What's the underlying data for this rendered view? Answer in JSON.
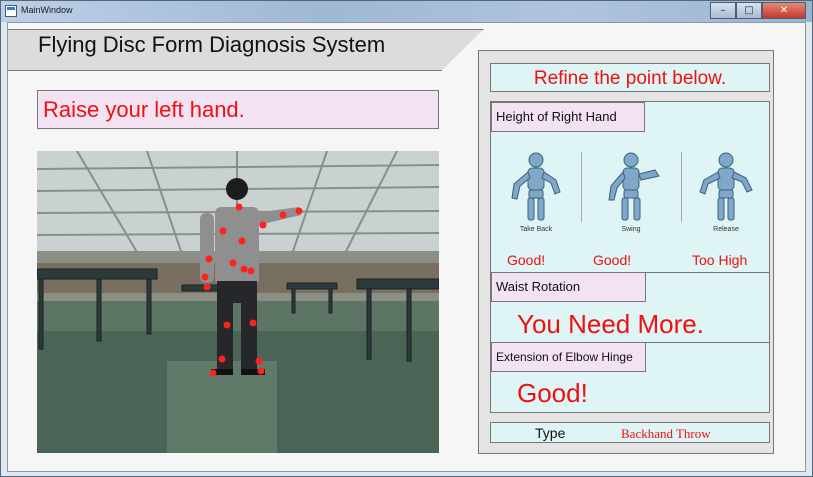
{
  "window": {
    "title": "MainWindow",
    "minimize_glyph": "–",
    "maximize_glyph": "□",
    "close_glyph": "✕"
  },
  "header": {
    "title": "Flying Disc Form Diagnosis System"
  },
  "instruction": {
    "text": "Raise your left hand."
  },
  "camera_feed": {
    "tracked_joint_color": "#ff2020"
  },
  "panel": {
    "heading": "Refine the point below.",
    "sections": [
      {
        "label": "Height of Right Hand",
        "phases": [
          {
            "label": "Take Back",
            "result": "Good!"
          },
          {
            "label": "Swing",
            "result": "Good!"
          },
          {
            "label": "Release",
            "result": "Too High"
          }
        ]
      },
      {
        "label": "Waist Rotation",
        "result": "You Need More."
      },
      {
        "label": "Extension of Elbow Hinge",
        "result": "Good!"
      }
    ],
    "type": {
      "label": "Type",
      "value": "Backhand Throw"
    }
  },
  "colors": {
    "feedback_text": "#f01010",
    "label_bg": "#f3e2f2",
    "panel_bg": "#dff4f4"
  }
}
